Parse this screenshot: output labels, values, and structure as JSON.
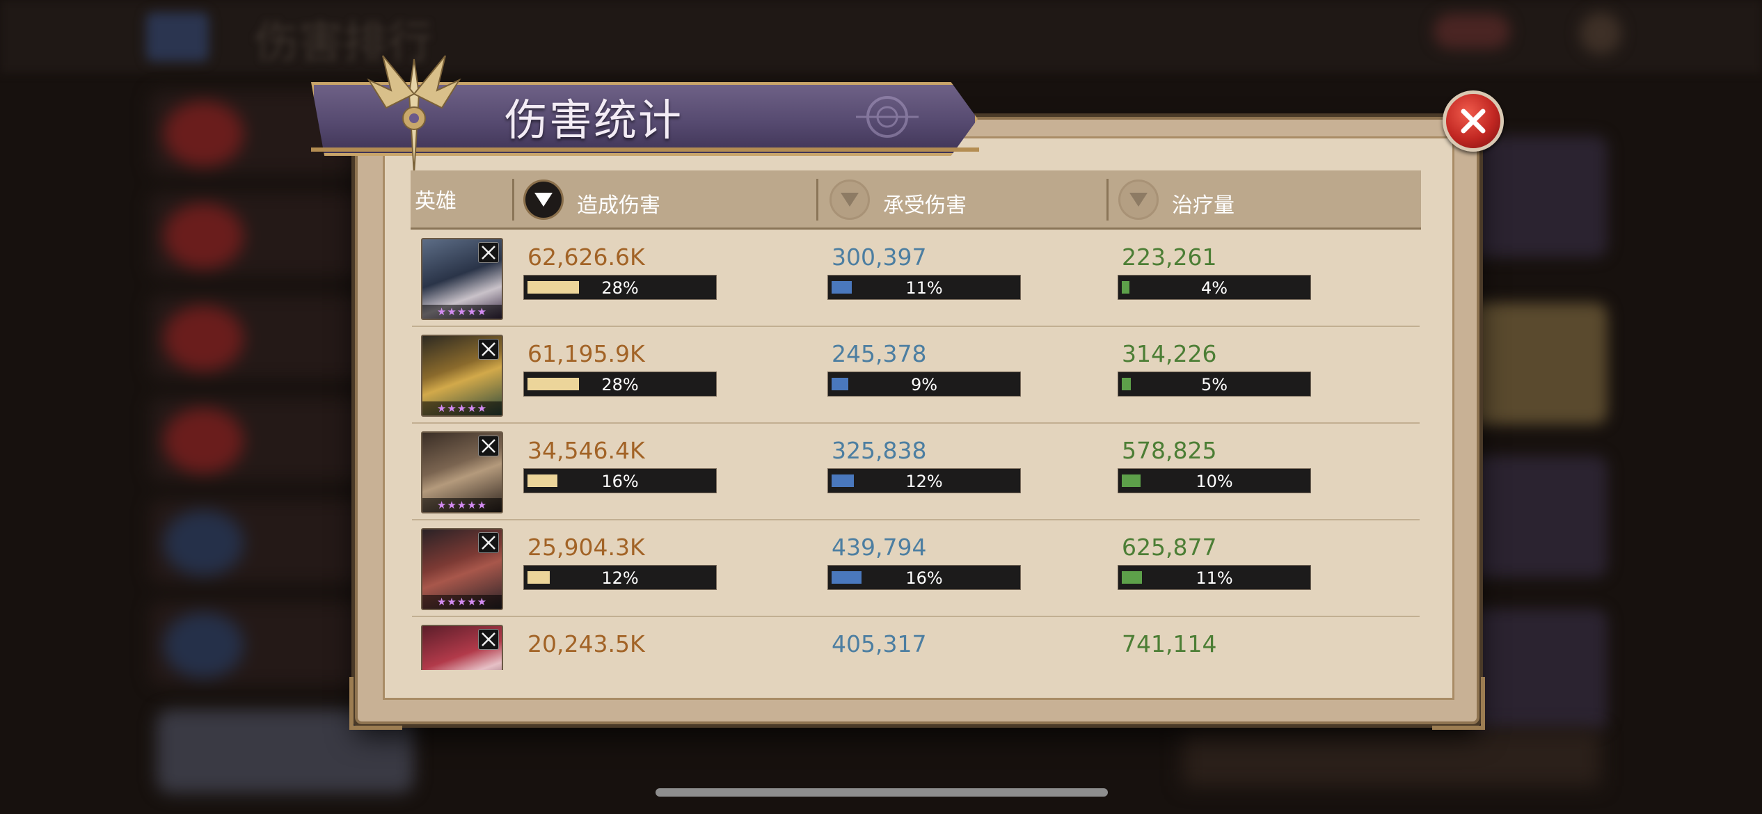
{
  "dialog": {
    "title": "伤害统计",
    "background_title": "伤害排行",
    "columns": {
      "hero": "英雄",
      "damage_dealt": "造成伤害",
      "damage_taken": "承受伤害",
      "healing": "治疗量"
    },
    "sort_active": "damage_dealt"
  },
  "heroes": [
    {
      "stars": "★★★★★",
      "dealt": "62,626.6K",
      "dealt_pct": "28%",
      "dealt_frac": 0.28,
      "taken": "300,397",
      "taken_pct": "11%",
      "taken_frac": 0.11,
      "heal": "223,261",
      "heal_pct": "4%",
      "heal_frac": 0.04
    },
    {
      "stars": "★★★★★",
      "dealt": "61,195.9K",
      "dealt_pct": "28%",
      "dealt_frac": 0.28,
      "taken": "245,378",
      "taken_pct": "9%",
      "taken_frac": 0.09,
      "heal": "314,226",
      "heal_pct": "5%",
      "heal_frac": 0.05
    },
    {
      "stars": "★★★★★",
      "dealt": "34,546.4K",
      "dealt_pct": "16%",
      "dealt_frac": 0.16,
      "taken": "325,838",
      "taken_pct": "12%",
      "taken_frac": 0.12,
      "heal": "578,825",
      "heal_pct": "10%",
      "heal_frac": 0.1
    },
    {
      "stars": "★★★★★",
      "dealt": "25,904.3K",
      "dealt_pct": "12%",
      "dealt_frac": 0.12,
      "taken": "439,794",
      "taken_pct": "16%",
      "taken_frac": 0.16,
      "heal": "625,877",
      "heal_pct": "11%",
      "heal_frac": 0.11
    },
    {
      "stars": "",
      "dealt": "20,243.5K",
      "dealt_pct": "",
      "dealt_frac": null,
      "taken": "405,317",
      "taken_pct": "",
      "taken_frac": null,
      "heal": "741,114",
      "heal_pct": "",
      "heal_frac": null
    }
  ],
  "colors": {
    "damage_dealt": "#a26326",
    "damage_taken": "#4c7ea1",
    "healing": "#4c7e35",
    "banner": "#564a70",
    "close": "#c12722"
  },
  "icons": {
    "close": "close-x-icon",
    "sort": "triangle-down-icon",
    "emblem": "winged-sword-emblem-icon",
    "class": "crossed-arrows-class-icon"
  }
}
